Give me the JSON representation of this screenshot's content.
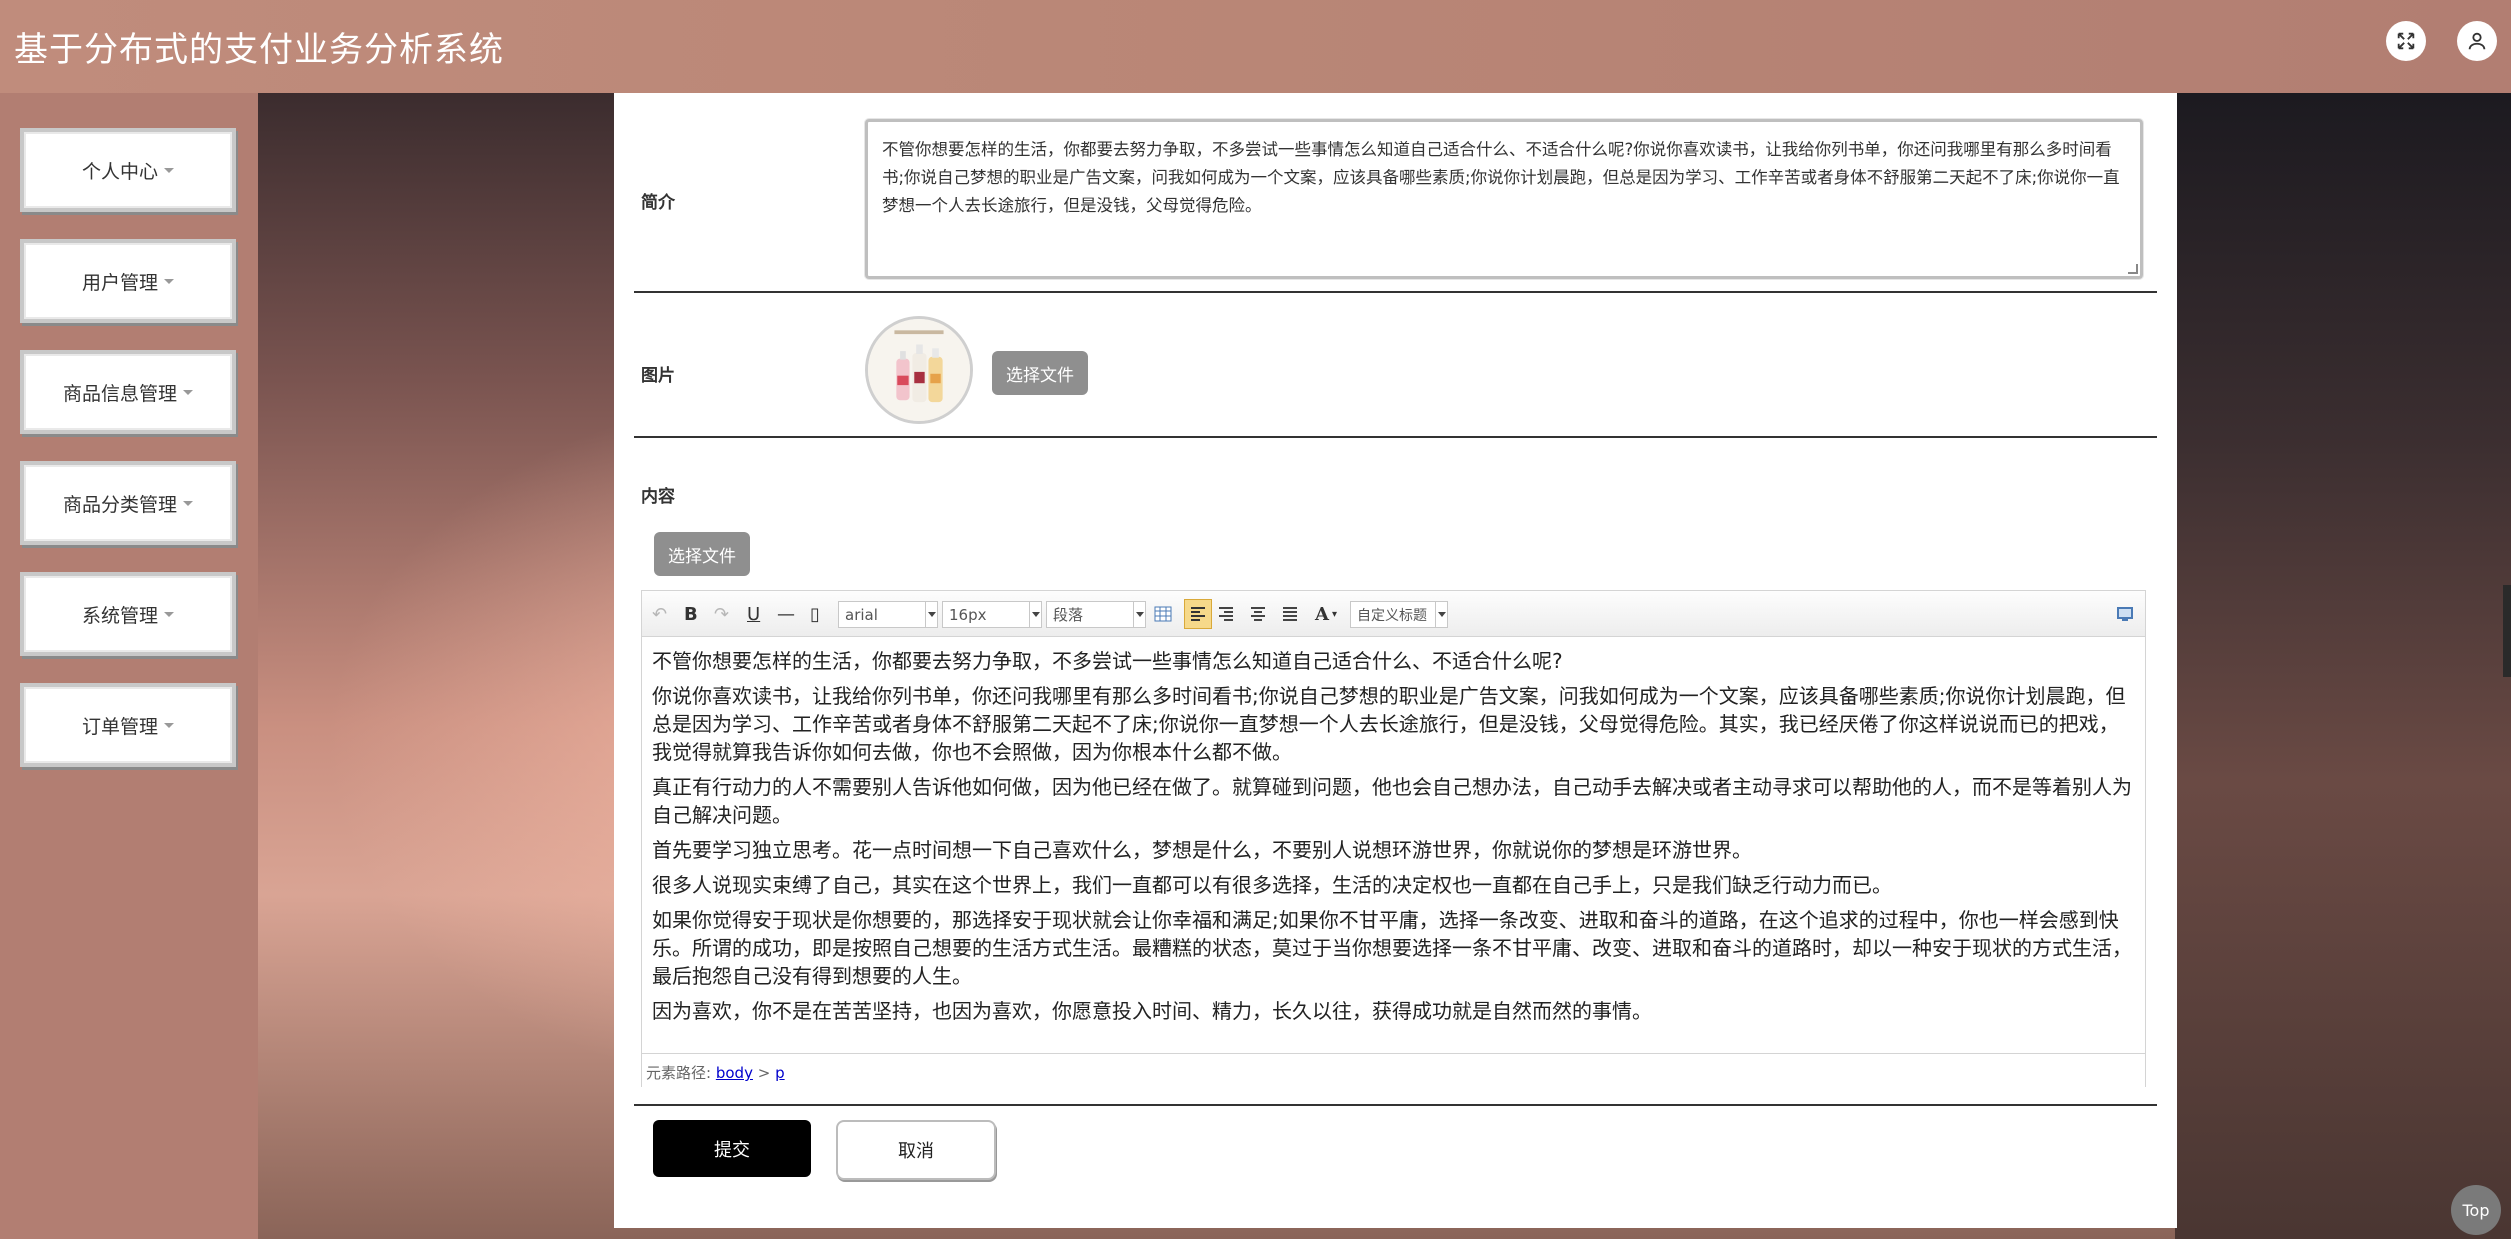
{
  "app": {
    "title": "基于分布式的支付业务分析系统"
  },
  "header": {
    "fullscreen_icon": "expand-icon",
    "user_icon": "user-icon"
  },
  "sidebar": {
    "items": [
      {
        "label": "个人中心"
      },
      {
        "label": "用户管理"
      },
      {
        "label": "商品信息管理"
      },
      {
        "label": "商品分类管理"
      },
      {
        "label": "系统管理"
      },
      {
        "label": "订单管理"
      }
    ]
  },
  "form": {
    "intro_label": "简介",
    "intro_value": "不管你想要怎样的生活，你都要去努力争取，不多尝试一些事情怎么知道自己适合什么、不适合什么呢?你说你喜欢读书，让我给你列书单，你还问我哪里有那么多时间看书;你说自己梦想的职业是广告文案，问我如何成为一个文案，应该具备哪些素质;你说你计划晨跑，但总是因为学习、工作辛苦或者身体不舒服第二天起不了床;你说你一直梦想一个人去长途旅行，但是没钱，父母觉得危险。",
    "image_label": "图片",
    "image_choose": "选择文件",
    "content_label": "内容",
    "content_choose": "选择文件",
    "submit": "提交",
    "cancel": "取消"
  },
  "editor": {
    "font_family": "arial",
    "font_size": "16px",
    "paragraph": "段落",
    "custom_title": "自定义标题",
    "paragraphs": [
      "不管你想要怎样的生活，你都要去努力争取，不多尝试一些事情怎么知道自己适合什么、不适合什么呢?",
      "你说你喜欢读书，让我给你列书单，你还问我哪里有那么多时间看书;你说自己梦想的职业是广告文案，问我如何成为一个文案，应该具备哪些素质;你说你计划晨跑，但总是因为学习、工作辛苦或者身体不舒服第二天起不了床;你说你一直梦想一个人去长途旅行，但是没钱，父母觉得危险。其实，我已经厌倦了你这样说说而已的把戏，我觉得就算我告诉你如何去做，你也不会照做，因为你根本什么都不做。",
      "真正有行动力的人不需要别人告诉他如何做，因为他已经在做了。就算碰到问题，他也会自己想办法，自己动手去解决或者主动寻求可以帮助他的人，而不是等着别人为自己解决问题。",
      "首先要学习独立思考。花一点时间想一下自己喜欢什么，梦想是什么，不要别人说想环游世界，你就说你的梦想是环游世界。",
      "很多人说现实束缚了自己，其实在这个世界上，我们一直都可以有很多选择，生活的决定权也一直都在自己手上，只是我们缺乏行动力而已。",
      "如果你觉得安于现状是你想要的，那选择安于现状就会让你幸福和满足;如果你不甘平庸，选择一条改变、进取和奋斗的道路，在这个追求的过程中，你也一样会感到快乐。所谓的成功，即是按照自己想要的生活方式生活。最糟糕的状态，莫过于当你想要选择一条不甘平庸、改变、进取和奋斗的道路时，却以一种安于现状的方式生活，最后抱怨自己没有得到想要的人生。",
      "因为喜欢，你不是在苦苦坚持，也因为喜欢，你愿意投入时间、精力，长久以往，获得成功就是自然而然的事情。"
    ],
    "path_label": "元素路径:",
    "path_body": "body",
    "path_sep": ">",
    "path_p": "p"
  },
  "misc": {
    "top": "Top"
  }
}
